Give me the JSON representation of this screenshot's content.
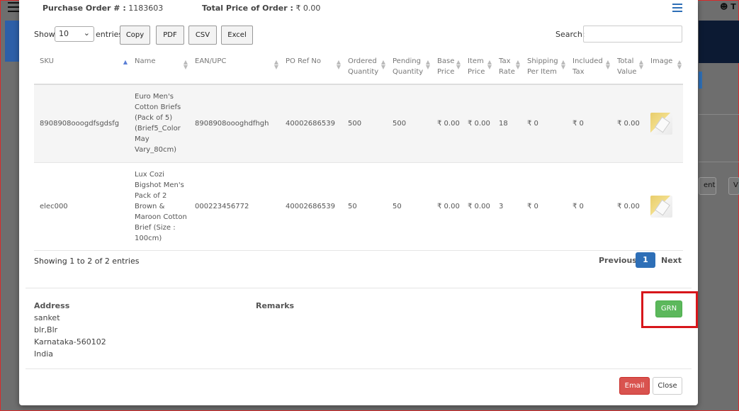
{
  "background": {
    "user_glyph": "T",
    "btn_partial_1": "ents",
    "btn_partial_2": "V"
  },
  "header": {
    "po_label": "Purchase Order # :",
    "po_number": "1183603",
    "total_price_label": "Total Price of Order :",
    "total_price_value": "₹ 0.00"
  },
  "controls": {
    "show_label": "Show",
    "page_length": "10",
    "entries_label": "entries",
    "buttons": [
      "Copy",
      "PDF",
      "CSV",
      "Excel"
    ],
    "search_label": "Search:"
  },
  "table": {
    "columns": [
      "SKU",
      "Name",
      "EAN/UPC",
      "PO Ref No",
      "Ordered Quantity",
      "Pending Quantity",
      "Base Price",
      "Item Price",
      "Tax Rate",
      "Shipping Per Item",
      "Included Tax",
      "Total Value",
      "Image"
    ],
    "rows": [
      {
        "sku": "8908908ooogdfsgdsfg",
        "name": "Euro Men's Cotton Briefs (Pack of 5) (Brief5_Color May Vary_80cm)",
        "ean": "8908908oooghdfhgh",
        "po_ref": "40002686539",
        "ordered": "500",
        "pending": "500",
        "base_price": "₹ 0.00",
        "item_price": "₹ 0.00",
        "tax_rate": "18",
        "shipping": "₹ 0",
        "included_tax": "₹ 0",
        "total_value": "₹ 0.00"
      },
      {
        "sku": "elec000",
        "name": "Lux Cozi Bigshot Men's Pack of 2 Brown & Maroon Cotton Brief (Size : 100cm)",
        "ean": "000223456772",
        "po_ref": "40002686539",
        "ordered": "50",
        "pending": "50",
        "base_price": "₹ 0.00",
        "item_price": "₹ 0.00",
        "tax_rate": "3",
        "shipping": "₹ 0",
        "included_tax": "₹ 0",
        "total_value": "₹ 0.00"
      }
    ]
  },
  "footer_info": "Showing 1 to 2 of 2 entries",
  "pagination": {
    "previous": "Previous",
    "current": "1",
    "next": "Next"
  },
  "address": {
    "title": "Address",
    "lines": [
      "sanket",
      "blr,Blr",
      "Karnataka-560102",
      "India"
    ]
  },
  "remarks": {
    "title": "Remarks"
  },
  "grn_button": "GRN",
  "actions": {
    "email": "Email",
    "close": "Close"
  },
  "colors": {
    "primary": "#2e6fb7",
    "success": "#5cb85c",
    "danger": "#d9534f",
    "highlight": "#d7161b"
  }
}
